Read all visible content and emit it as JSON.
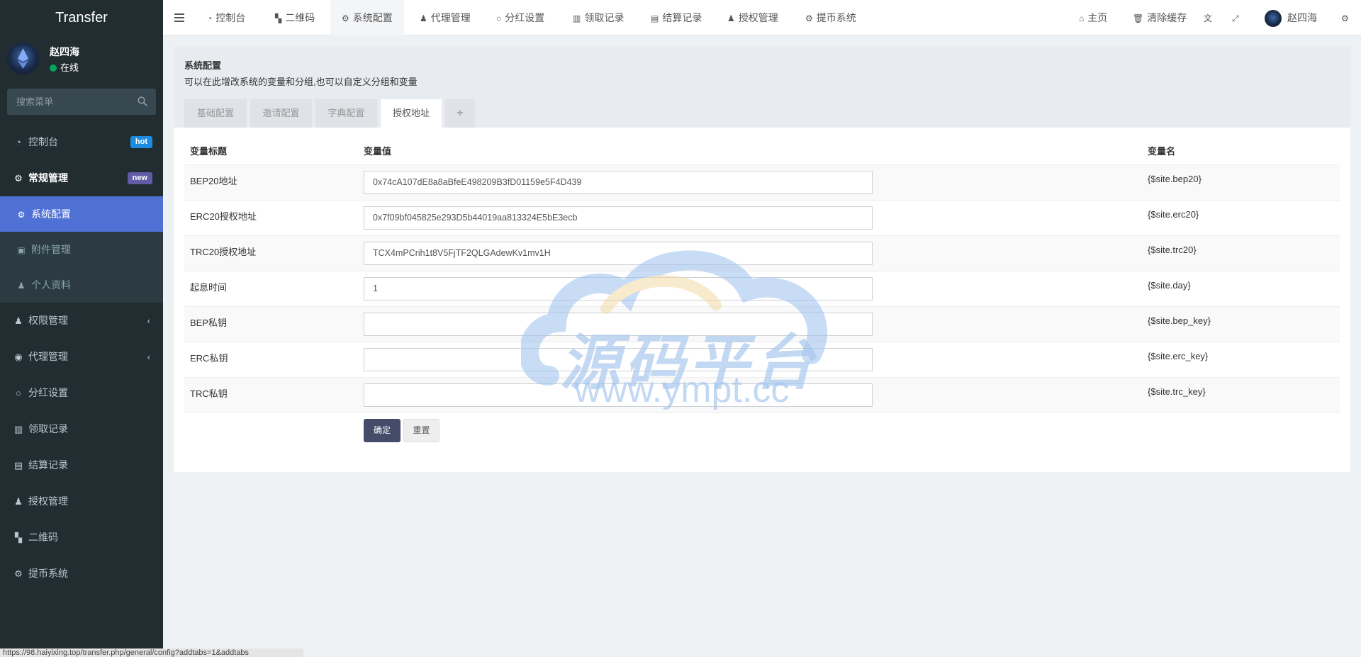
{
  "app": {
    "title": "Transfer"
  },
  "user": {
    "name": "赵四海",
    "status": "在线"
  },
  "sidebar": {
    "search_placeholder": "搜索菜单",
    "items": [
      {
        "label": "控制台",
        "badge": "hot",
        "icon": "dashboard-icon"
      },
      {
        "label": "常规管理",
        "badge": "new",
        "icon": "cogs-icon"
      },
      {
        "label": "系统配置",
        "icon": "gear-icon"
      },
      {
        "label": "附件管理",
        "icon": "image-icon"
      },
      {
        "label": "个人资料",
        "icon": "user-icon"
      },
      {
        "label": "权限管理",
        "icon": "group-icon"
      },
      {
        "label": "代理管理",
        "icon": "user-circle-icon"
      },
      {
        "label": "分红设置",
        "icon": "circle-icon"
      },
      {
        "label": "领取记录",
        "icon": "chart-icon"
      },
      {
        "label": "结算记录",
        "icon": "money-icon"
      },
      {
        "label": "授权管理",
        "icon": "group-icon"
      },
      {
        "label": "二维码",
        "icon": "qrcode-icon"
      },
      {
        "label": "提币系统",
        "icon": "gear-icon"
      }
    ]
  },
  "topnav": {
    "tabs": [
      "控制台",
      "二维码",
      "系统配置",
      "代理管理",
      "分红设置",
      "领取记录",
      "结算记录",
      "授权管理",
      "提币系统"
    ],
    "home": "主页",
    "clear_cache": "清除缓存",
    "user": "赵四海"
  },
  "content": {
    "title": "系统配置",
    "description": "可以在此增改系统的变量和分组,也可以自定义分组和变量",
    "tabs": [
      "基础配置",
      "邀请配置",
      "字典配置",
      "授权地址",
      "+"
    ],
    "columns": [
      "变量标题",
      "变量值",
      "变量名"
    ],
    "rows": [
      {
        "title": "BEP20地址",
        "value": "0x74cA107dE8a8aBfeE498209B3fD01159e5F4D439",
        "name": "{$site.bep20}"
      },
      {
        "title": "ERC20授权地址",
        "value": "0x7f09bf045825e293D5b44019aa813324E5bE3ecb",
        "name": "{$site.erc20}"
      },
      {
        "title": "TRC20授权地址",
        "value": "TCX4mPCrih1t8V5FjTF2QLGAdewKv1mv1H",
        "name": "{$site.trc20}"
      },
      {
        "title": "起息时间",
        "value": "1",
        "name": "{$site.day}"
      },
      {
        "title": "BEP私钥",
        "value": "",
        "name": "{$site.bep_key}"
      },
      {
        "title": "ERC私钥",
        "value": "",
        "name": "{$site.erc_key}"
      },
      {
        "title": "TRC私钥",
        "value": "",
        "name": "{$site.trc_key}"
      }
    ],
    "submit_label": "确定",
    "reset_label": "重置"
  },
  "watermark": {
    "text": "源码平台",
    "url": "www.ympt.cc"
  },
  "statusbar": {
    "url": "https://98.haiyixing.top/transfer.php/general/config?addtabs=1&addtabs"
  },
  "colors": {
    "sidebar_bg": "#222d32",
    "active_item": "#4f70d4",
    "primary_button": "#444c69",
    "badge_hot": "#1d8ce0",
    "badge_new": "#605ca8"
  }
}
